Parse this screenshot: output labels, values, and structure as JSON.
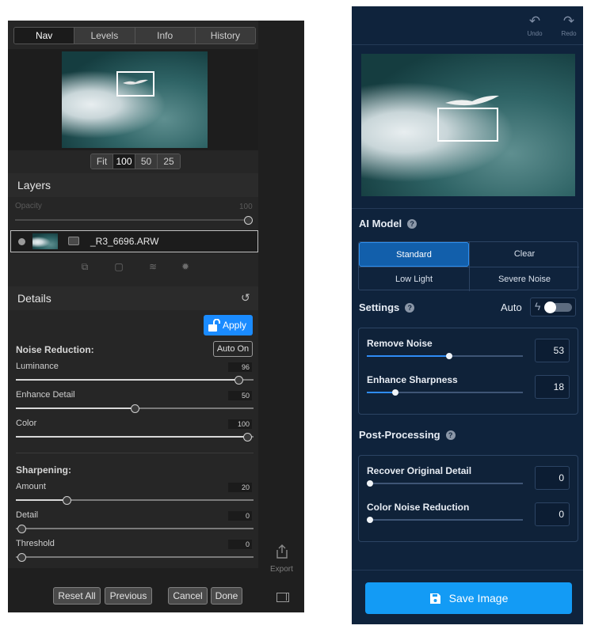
{
  "left": {
    "tabs": [
      "Nav",
      "Levels",
      "Info",
      "History"
    ],
    "zoom_options": [
      "Fit",
      "100",
      "50",
      "25"
    ],
    "layers": {
      "title": "Layers",
      "opacity_label": "Opacity",
      "opacity_value": "100",
      "layer_name": "_R3_6696.ARW"
    },
    "details": {
      "title": "Details",
      "apply_label": "Apply",
      "noise_reduction_label": "Noise Reduction:",
      "auto_on_label": "Auto On",
      "sliders": [
        {
          "label": "Luminance",
          "value": "96"
        },
        {
          "label": "Enhance Detail",
          "value": "50"
        },
        {
          "label": "Color",
          "value": "100"
        }
      ],
      "sharpening_label": "Sharpening:",
      "sharpening_sliders": [
        {
          "label": "Amount",
          "value": "20"
        },
        {
          "label": "Detail",
          "value": "0"
        },
        {
          "label": "Threshold",
          "value": "0"
        }
      ]
    },
    "export_label": "Export",
    "buttons": {
      "reset_all": "Reset All",
      "previous": "Previous",
      "cancel": "Cancel",
      "done": "Done"
    }
  },
  "right": {
    "undo_label": "Undo",
    "redo_label": "Redo",
    "ai_model": {
      "title": "AI Model",
      "options": [
        "Standard",
        "Clear",
        "Low Light",
        "Severe Noise"
      ],
      "selected": "Standard"
    },
    "settings": {
      "title": "Settings",
      "auto_label": "Auto",
      "auto_enabled": false,
      "sliders": [
        {
          "label": "Remove Noise",
          "value": "53"
        },
        {
          "label": "Enhance Sharpness",
          "value": "18"
        }
      ]
    },
    "post_processing": {
      "title": "Post-Processing",
      "sliders": [
        {
          "label": "Recover Original Detail",
          "value": "0"
        },
        {
          "label": "Color Noise Reduction",
          "value": "0"
        }
      ]
    },
    "save_label": "Save Image",
    "accent_color": "#139bf5"
  }
}
